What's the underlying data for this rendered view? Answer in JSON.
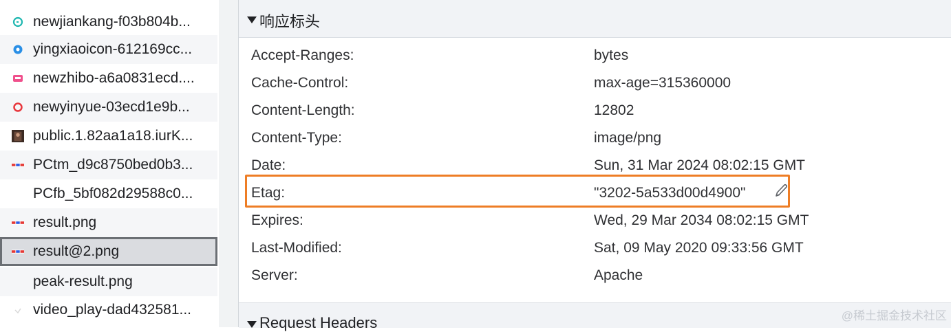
{
  "request_list": [
    {
      "name": "newjiankang-f03b804b...",
      "icon": "jiankang-icon",
      "color": "#1fb7b0"
    },
    {
      "name": "yingxiaoicon-612169cc...",
      "icon": "yingxiao-icon",
      "color": "#2a8fe6"
    },
    {
      "name": "newzhibo-a6a0831ecd....",
      "icon": "zhibo-icon",
      "color": "#f0508c"
    },
    {
      "name": "newyinyue-03ecd1e9b...",
      "icon": "yinyue-icon",
      "color": "#e8363c"
    },
    {
      "name": "public.1.82aa1a18.iurK...",
      "icon": "photo-thumbnail-icon",
      "color": "#6b4a3a"
    },
    {
      "name": "PCtm_d9c8750bed0b3...",
      "icon": "baidu-logo-icon",
      "color": "#2d5be3"
    },
    {
      "name": "PCfb_5bf082d29588c0...",
      "icon": "blank-icon",
      "color": "#ffffff"
    },
    {
      "name": "result.png",
      "icon": "baidu-logo-icon",
      "color": "#2d5be3"
    },
    {
      "name": "result@2.png",
      "icon": "baidu-logo-icon",
      "color": "#2d5be3",
      "selected": true
    },
    {
      "name": "peak-result.png",
      "icon": "blank-icon",
      "color": "#ffffff"
    },
    {
      "name": "video_play-dad432581...",
      "icon": "video-icon",
      "color": "#d8d8d8"
    }
  ],
  "response_headers": {
    "title": "响应标头",
    "rows": [
      {
        "key": "Accept-Ranges:",
        "value": "bytes"
      },
      {
        "key": "Cache-Control:",
        "value": "max-age=315360000"
      },
      {
        "key": "Content-Length:",
        "value": "12802"
      },
      {
        "key": "Content-Type:",
        "value": "image/png"
      },
      {
        "key": "Date:",
        "value": "Sun, 31 Mar 2024 08:02:15 GMT"
      },
      {
        "key": "Etag:",
        "value": "\"3202-5a533d00d4900\"",
        "highlighted": true
      },
      {
        "key": "Expires:",
        "value": "Wed, 29 Mar 2034 08:02:15 GMT"
      },
      {
        "key": "Last-Modified:",
        "value": "Sat, 09 May 2020 09:33:56 GMT"
      },
      {
        "key": "Server:",
        "value": "Apache"
      }
    ]
  },
  "request_headers": {
    "title": "Request Headers"
  },
  "watermark": "@稀土掘金技术社区",
  "colors": {
    "highlight": "#ee7d25",
    "selected_row": "#dadce0"
  }
}
